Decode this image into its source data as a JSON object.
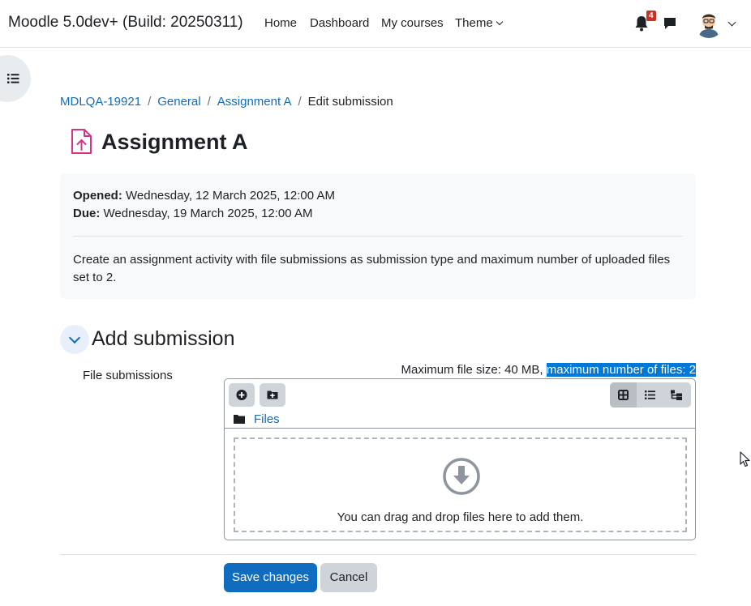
{
  "navbar": {
    "brand": "Moodle 5.0dev+ (Build: 20250311)",
    "links": [
      "Home",
      "Dashboard",
      "My courses",
      "Theme"
    ],
    "notifications_count": "4",
    "icons": [
      "bell-icon",
      "message-icon",
      "user-avatar",
      "chevron-down-icon"
    ]
  },
  "breadcrumb": {
    "items": [
      "MDLQA-19921",
      "General",
      "Assignment A"
    ],
    "current": "Edit submission"
  },
  "page": {
    "title": "Assignment A",
    "icon": "assignment-upload-icon",
    "accent_color": "#d63384"
  },
  "info": {
    "opened_label": "Opened:",
    "opened_value": "Wednesday, 12 March 2025, 12:00 AM",
    "due_label": "Due:",
    "due_value": "Wednesday, 19 March 2025, 12:00 AM",
    "description": "Create an assignment activity with file submissions as submission type and maximum number of uploaded files set to 2."
  },
  "section": {
    "title": "Add submission",
    "field_label": "File submissions",
    "limits_plain": "Maximum file size: 40 MB, ",
    "limits_highlight": "maximum number of files: 2"
  },
  "filemanager": {
    "path_label": "Files",
    "drop_text": "You can drag and drop files here to add them.",
    "view_modes": [
      "icons-view",
      "list-view",
      "tree-view"
    ]
  },
  "buttons": {
    "save": "Save changes",
    "cancel": "Cancel"
  },
  "colors": {
    "primary": "#0f6cbf",
    "badge": "#ca3120",
    "selection": "#0078d7"
  }
}
